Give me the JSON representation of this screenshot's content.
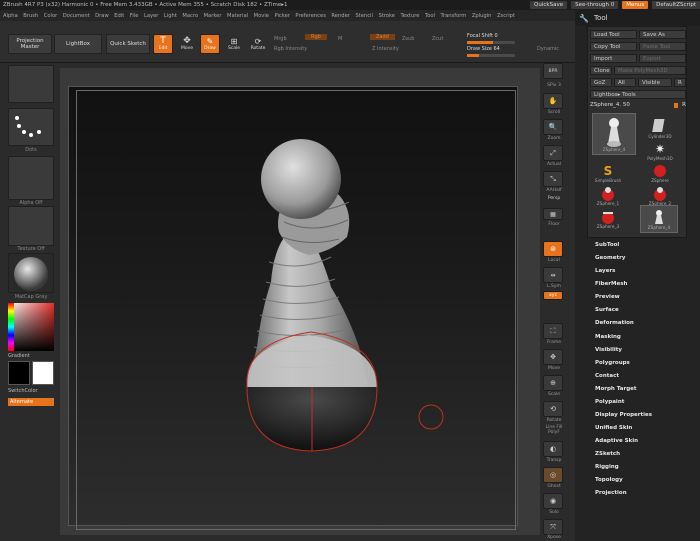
{
  "titlebar": {
    "text": "ZBrush 4R7 P3 (x32)    Harmonic 0    • Free Mem 3.433GB • Active Mem 355 • Scratch Disk 182 • ZTime▸1",
    "quicksave": "QuickSave",
    "seethrough": "See-through 0",
    "menus": "Menus",
    "zscript": "DefaultZScript"
  },
  "menubar": [
    "Alpha",
    "Brush",
    "Color",
    "Document",
    "Draw",
    "Edit",
    "File",
    "Layer",
    "Light",
    "Macro",
    "Marker",
    "Material",
    "Movie",
    "Picker",
    "Preferences",
    "Render",
    "Stencil",
    "Stroke",
    "Texture",
    "Tool",
    "Transform",
    "Zplugin",
    "Zscript"
  ],
  "shelf": {
    "projection_master": "Projection Master",
    "lightbox": "LightBox",
    "quick_sketch": "Quick Sketch",
    "edit": "Edit",
    "draw": "Draw",
    "move": "Move",
    "scale": "Scale",
    "rotate": "Rotate",
    "mrgb": "Mrgb",
    "rgb": "Rgb",
    "m": "M",
    "rgb_intensity": "Rgb Intensity",
    "zadd": "Zadd",
    "zsub": "Zsub",
    "zcut": "Zcut",
    "z_intensity": "Z Intensity",
    "focal_shift": "Focal Shift 0",
    "draw_size": "Draw Size 64",
    "dynamic": "Dynamic",
    "focal_shift_level": 0.55,
    "draw_size_level": 0.25
  },
  "leftpanel": {
    "brush_label": "Dots",
    "alpha_label": "Alpha Off",
    "texture_label": "Texture Off",
    "material_label": "MatCap Gray",
    "gradient": "Gradient",
    "switchcolor": "SwitchColor",
    "alternate": "Alternate"
  },
  "rstrip": {
    "bpr": "BPR",
    "spix": "SPix 3",
    "scroll": "Scroll",
    "zoom": "Zoom",
    "actual": "Actual",
    "aahalf": "AAHalf",
    "persp": "Persp",
    "floor": "Floor",
    "local": "Local",
    "lsym": "L.Sym",
    "xyz": "xyz",
    "frame": "Frame",
    "move": "Move",
    "scale": "Scale",
    "rotate": "Rotate",
    "linefill": "Line Fill PolyF",
    "transp": "Transp",
    "ghost": "Ghost",
    "solo": "Solo",
    "xpose": "Xpose"
  },
  "tool": {
    "title": "Tool",
    "load_tool": "Load Tool",
    "save_as": "Save As",
    "copy_tool": "Copy Tool",
    "paste_tool": "Paste Tool",
    "import": "Import",
    "export": "Export",
    "clone": "Clone",
    "make_polymesh": "Make PolyMesh3D",
    "goz": "GoZ",
    "all": "All",
    "visible": "Visible",
    "r": "R",
    "lightbox_tools": "Lightbox▸ Tools",
    "current_tool": "ZSphere_4. 50",
    "items": [
      {
        "name": "ZSphere_4",
        "icon": "pawn-icon"
      },
      {
        "name": "Cylinder3D",
        "icon": "cylinder-icon"
      },
      {
        "name": "PolyMesh3D",
        "icon": "star-icon"
      },
      {
        "name": "SimpleBrush",
        "icon": "s-brush-icon"
      },
      {
        "name": "ZSphere",
        "icon": "sphere-icon"
      },
      {
        "name": "ZSphere_1",
        "icon": "sphere-icon"
      },
      {
        "name": "ZSphere_2",
        "icon": "sphere-icon"
      },
      {
        "name": "ZSphere_3",
        "icon": "sphere-icon"
      },
      {
        "name": "ZSphere_4",
        "icon": "pawn-icon"
      }
    ],
    "subpalettes": [
      "SubTool",
      "Geometry",
      "Layers",
      "FiberMesh",
      "Preview",
      "Surface",
      "Deformation",
      "Masking",
      "Visibility",
      "Polygroups",
      "Contact",
      "Morph Target",
      "Polypaint",
      "Display Properties",
      "Unified Skin",
      "Adaptive Skin",
      "ZSketch",
      "Rigging",
      "Topology",
      "Projection"
    ]
  },
  "colors": {
    "accent": "#e8731d",
    "panel": "#2b2b2b"
  }
}
